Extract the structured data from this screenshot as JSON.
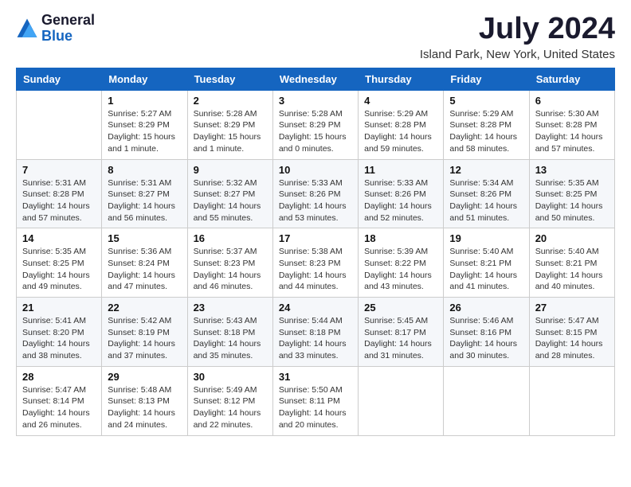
{
  "logo": {
    "general": "General",
    "blue": "Blue"
  },
  "title": "July 2024",
  "subtitle": "Island Park, New York, United States",
  "headers": [
    "Sunday",
    "Monday",
    "Tuesday",
    "Wednesday",
    "Thursday",
    "Friday",
    "Saturday"
  ],
  "weeks": [
    [
      {
        "day": "",
        "info": ""
      },
      {
        "day": "1",
        "info": "Sunrise: 5:27 AM\nSunset: 8:29 PM\nDaylight: 15 hours\nand 1 minute."
      },
      {
        "day": "2",
        "info": "Sunrise: 5:28 AM\nSunset: 8:29 PM\nDaylight: 15 hours\nand 1 minute."
      },
      {
        "day": "3",
        "info": "Sunrise: 5:28 AM\nSunset: 8:29 PM\nDaylight: 15 hours\nand 0 minutes."
      },
      {
        "day": "4",
        "info": "Sunrise: 5:29 AM\nSunset: 8:28 PM\nDaylight: 14 hours\nand 59 minutes."
      },
      {
        "day": "5",
        "info": "Sunrise: 5:29 AM\nSunset: 8:28 PM\nDaylight: 14 hours\nand 58 minutes."
      },
      {
        "day": "6",
        "info": "Sunrise: 5:30 AM\nSunset: 8:28 PM\nDaylight: 14 hours\nand 57 minutes."
      }
    ],
    [
      {
        "day": "7",
        "info": "Sunrise: 5:31 AM\nSunset: 8:28 PM\nDaylight: 14 hours\nand 57 minutes."
      },
      {
        "day": "8",
        "info": "Sunrise: 5:31 AM\nSunset: 8:27 PM\nDaylight: 14 hours\nand 56 minutes."
      },
      {
        "day": "9",
        "info": "Sunrise: 5:32 AM\nSunset: 8:27 PM\nDaylight: 14 hours\nand 55 minutes."
      },
      {
        "day": "10",
        "info": "Sunrise: 5:33 AM\nSunset: 8:26 PM\nDaylight: 14 hours\nand 53 minutes."
      },
      {
        "day": "11",
        "info": "Sunrise: 5:33 AM\nSunset: 8:26 PM\nDaylight: 14 hours\nand 52 minutes."
      },
      {
        "day": "12",
        "info": "Sunrise: 5:34 AM\nSunset: 8:26 PM\nDaylight: 14 hours\nand 51 minutes."
      },
      {
        "day": "13",
        "info": "Sunrise: 5:35 AM\nSunset: 8:25 PM\nDaylight: 14 hours\nand 50 minutes."
      }
    ],
    [
      {
        "day": "14",
        "info": "Sunrise: 5:35 AM\nSunset: 8:25 PM\nDaylight: 14 hours\nand 49 minutes."
      },
      {
        "day": "15",
        "info": "Sunrise: 5:36 AM\nSunset: 8:24 PM\nDaylight: 14 hours\nand 47 minutes."
      },
      {
        "day": "16",
        "info": "Sunrise: 5:37 AM\nSunset: 8:23 PM\nDaylight: 14 hours\nand 46 minutes."
      },
      {
        "day": "17",
        "info": "Sunrise: 5:38 AM\nSunset: 8:23 PM\nDaylight: 14 hours\nand 44 minutes."
      },
      {
        "day": "18",
        "info": "Sunrise: 5:39 AM\nSunset: 8:22 PM\nDaylight: 14 hours\nand 43 minutes."
      },
      {
        "day": "19",
        "info": "Sunrise: 5:40 AM\nSunset: 8:21 PM\nDaylight: 14 hours\nand 41 minutes."
      },
      {
        "day": "20",
        "info": "Sunrise: 5:40 AM\nSunset: 8:21 PM\nDaylight: 14 hours\nand 40 minutes."
      }
    ],
    [
      {
        "day": "21",
        "info": "Sunrise: 5:41 AM\nSunset: 8:20 PM\nDaylight: 14 hours\nand 38 minutes."
      },
      {
        "day": "22",
        "info": "Sunrise: 5:42 AM\nSunset: 8:19 PM\nDaylight: 14 hours\nand 37 minutes."
      },
      {
        "day": "23",
        "info": "Sunrise: 5:43 AM\nSunset: 8:18 PM\nDaylight: 14 hours\nand 35 minutes."
      },
      {
        "day": "24",
        "info": "Sunrise: 5:44 AM\nSunset: 8:18 PM\nDaylight: 14 hours\nand 33 minutes."
      },
      {
        "day": "25",
        "info": "Sunrise: 5:45 AM\nSunset: 8:17 PM\nDaylight: 14 hours\nand 31 minutes."
      },
      {
        "day": "26",
        "info": "Sunrise: 5:46 AM\nSunset: 8:16 PM\nDaylight: 14 hours\nand 30 minutes."
      },
      {
        "day": "27",
        "info": "Sunrise: 5:47 AM\nSunset: 8:15 PM\nDaylight: 14 hours\nand 28 minutes."
      }
    ],
    [
      {
        "day": "28",
        "info": "Sunrise: 5:47 AM\nSunset: 8:14 PM\nDaylight: 14 hours\nand 26 minutes."
      },
      {
        "day": "29",
        "info": "Sunrise: 5:48 AM\nSunset: 8:13 PM\nDaylight: 14 hours\nand 24 minutes."
      },
      {
        "day": "30",
        "info": "Sunrise: 5:49 AM\nSunset: 8:12 PM\nDaylight: 14 hours\nand 22 minutes."
      },
      {
        "day": "31",
        "info": "Sunrise: 5:50 AM\nSunset: 8:11 PM\nDaylight: 14 hours\nand 20 minutes."
      },
      {
        "day": "",
        "info": ""
      },
      {
        "day": "",
        "info": ""
      },
      {
        "day": "",
        "info": ""
      }
    ]
  ]
}
